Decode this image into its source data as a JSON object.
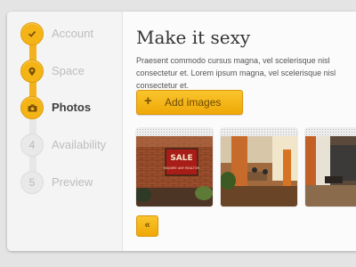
{
  "steps": [
    {
      "number": "",
      "label": "Account",
      "state": "done",
      "icon": "check-icon"
    },
    {
      "number": "",
      "label": "Space",
      "state": "done",
      "icon": "map-pin-icon"
    },
    {
      "number": "",
      "label": "Photos",
      "state": "current",
      "icon": "camera-icon"
    },
    {
      "number": "4",
      "label": "Availability",
      "state": "todo"
    },
    {
      "number": "5",
      "label": "Preview",
      "state": "todo"
    }
  ],
  "main": {
    "title": "Make it sexy",
    "description": "Praesent commodo cursus magna, vel scelerisque nisl consectetur et. Lorem ipsum magna, vel scelerisque nisl consectetur et.",
    "add_button": {
      "label": "Add images",
      "icon": "plus-icon"
    },
    "photos": [
      {
        "sign_text": "SALE",
        "sign_subtext": "INQUIRE ANY REALTOR"
      },
      {},
      {}
    ],
    "prev_button": {
      "label": "«"
    }
  },
  "colors": {
    "accent": "#f5b416",
    "accent_dark": "#d9950a"
  }
}
